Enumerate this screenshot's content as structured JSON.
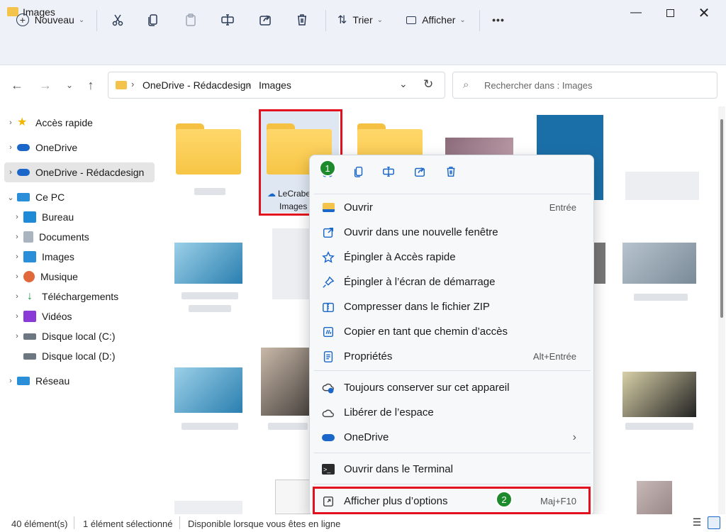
{
  "window": {
    "title": "Images"
  },
  "toolbar": {
    "new_label": "Nouveau",
    "sort_label": "Trier",
    "view_label": "Afficher",
    "more_label": "•••"
  },
  "address": {
    "segments": [
      "OneDrive - Rédacdesign",
      "Images"
    ]
  },
  "search": {
    "placeholder": "Rechercher dans : Images"
  },
  "sidebar": {
    "items": [
      {
        "label": "Accès rapide"
      },
      {
        "label": "OneDrive"
      },
      {
        "label": "OneDrive - Rédacdesign"
      },
      {
        "label": "Ce PC"
      },
      {
        "label": "Bureau"
      },
      {
        "label": "Documents"
      },
      {
        "label": "Images"
      },
      {
        "label": "Musique"
      },
      {
        "label": "Téléchargements"
      },
      {
        "label": "Vidéos"
      },
      {
        "label": "Disque local (C:)"
      },
      {
        "label": "Disque local (D:)"
      },
      {
        "label": "Réseau"
      }
    ]
  },
  "selected_folder": {
    "line1": "LeCrabe",
    "line2": "Images"
  },
  "context_menu": {
    "items": [
      {
        "label": "Ouvrir",
        "shortcut": "Entrée"
      },
      {
        "label": "Ouvrir dans une nouvelle fenêtre",
        "shortcut": ""
      },
      {
        "label": "Épingler à Accès rapide",
        "shortcut": ""
      },
      {
        "label": "Épingler à l’écran de démarrage",
        "shortcut": ""
      },
      {
        "label": "Compresser dans le fichier ZIP",
        "shortcut": ""
      },
      {
        "label": "Copier en tant que chemin d’accès",
        "shortcut": ""
      },
      {
        "label": "Propriétés",
        "shortcut": "Alt+Entrée"
      },
      {
        "label": "Toujours conserver sur cet appareil",
        "shortcut": ""
      },
      {
        "label": "Libérer de l’espace",
        "shortcut": ""
      },
      {
        "label": "OneDrive",
        "shortcut": "›"
      },
      {
        "label": "Ouvrir dans le Terminal",
        "shortcut": ""
      },
      {
        "label": "Afficher plus d’options",
        "shortcut": "Maj+F10"
      }
    ]
  },
  "badges": {
    "one": "1",
    "two": "2"
  },
  "status": {
    "count": "40 élément(s)",
    "selected": "1 élément sélectionné",
    "availability": "Disponible lorsque vous êtes en ligne"
  },
  "colors": {
    "accent": "#1b66c9",
    "highlight": "#e3101d",
    "badge": "#1d8a2c",
    "folder": "#f6c545"
  }
}
